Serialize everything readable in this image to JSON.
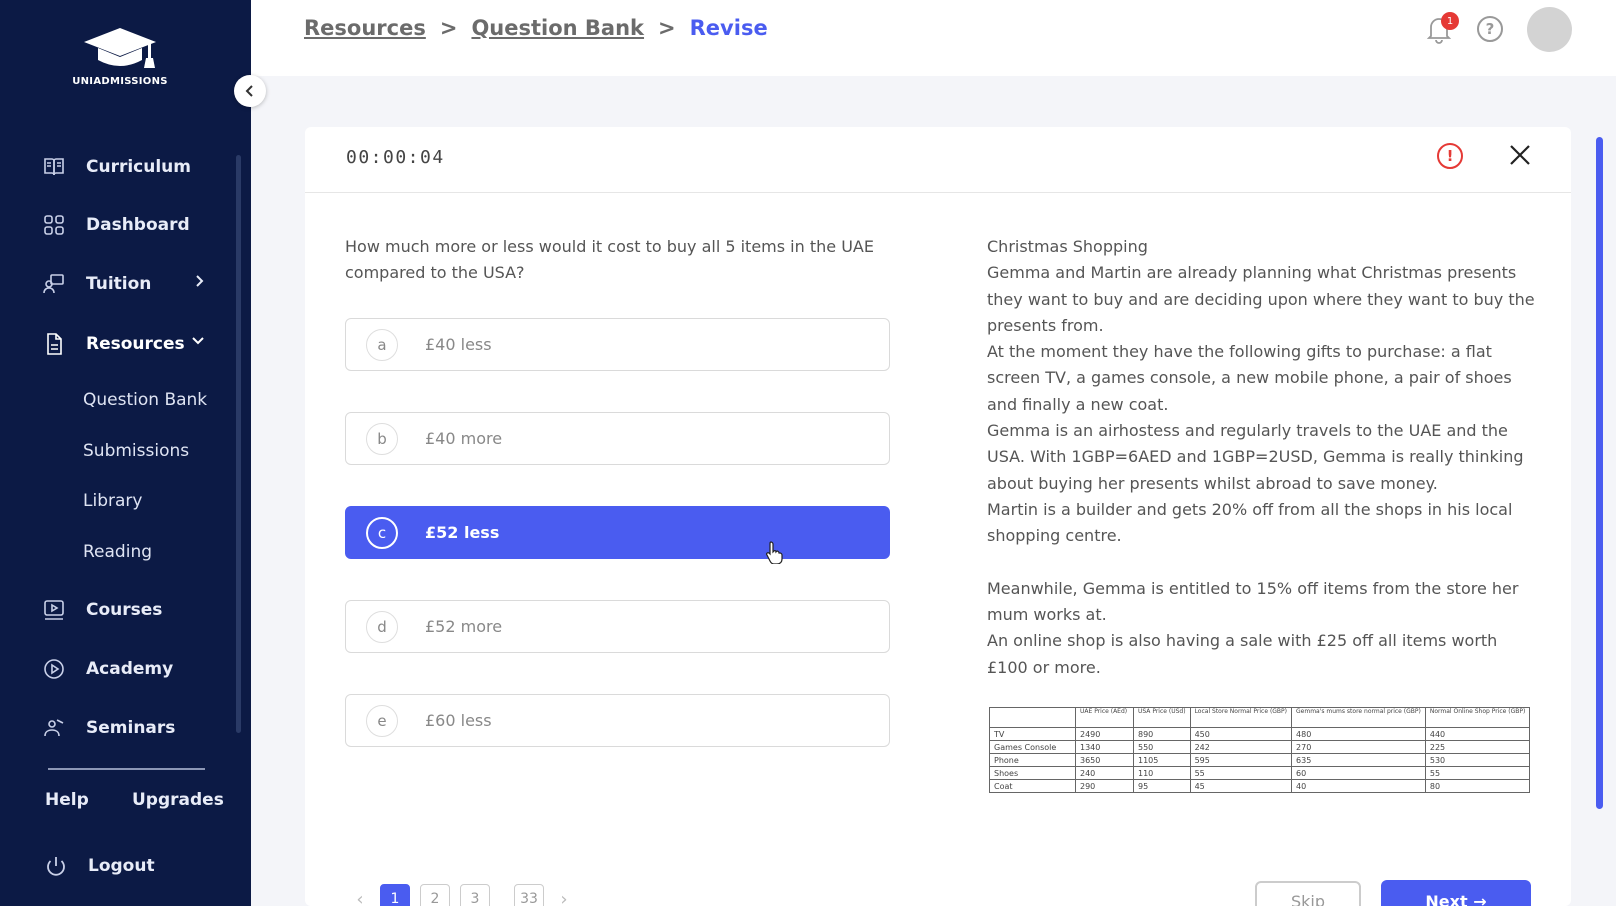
{
  "brand": {
    "name": "UNIADMISSIONS"
  },
  "sidebar": {
    "items": [
      {
        "label": "Curriculum",
        "icon": "book-icon"
      },
      {
        "label": "Dashboard",
        "icon": "grid-icon"
      },
      {
        "label": "Tuition",
        "icon": "tutor-icon"
      },
      {
        "label": "Resources",
        "icon": "document-icon"
      },
      {
        "label": "Courses",
        "icon": "video-icon"
      },
      {
        "label": "Academy",
        "icon": "play-icon"
      },
      {
        "label": "Seminars",
        "icon": "presenter-icon"
      }
    ],
    "resources_sub": [
      "Question Bank",
      "Submissions",
      "Library",
      "Reading"
    ],
    "help_label": "Help",
    "upgrades_label": "Upgrades",
    "logout_label": "Logout"
  },
  "breadcrumb": {
    "items": [
      "Resources",
      "Question Bank"
    ],
    "separator": ">",
    "current": "Revise"
  },
  "header": {
    "notification_count": "1",
    "help_glyph": "?"
  },
  "quiz": {
    "timer": "00:00:04",
    "report_glyph": "!",
    "question": "How much more or less would it cost to buy all 5 items in the UAE compared to the USA?",
    "options": [
      {
        "letter": "a",
        "text": "£40 less"
      },
      {
        "letter": "b",
        "text": "£40 more"
      },
      {
        "letter": "c",
        "text": "£52 less"
      },
      {
        "letter": "d",
        "text": "£52 more"
      },
      {
        "letter": "e",
        "text": "£60 less"
      }
    ],
    "selected": "c",
    "passage": [
      "Christmas Shopping",
      "Gemma and Martin are already planning what Christmas presents they want to buy and are deciding upon where they want to buy the presents from.",
      "At the moment they have the following gifts to purchase: a flat screen TV, a games console, a new mobile phone, a pair of shoes and finally a new coat.",
      "Gemma is an airhostess and regularly travels to the UAE and the USA. With 1GBP=6AED and 1GBP=2USD, Gemma is really thinking about buying her presents whilst abroad to save money.",
      "Martin is a builder and gets 20% off from all the shops in his local shopping centre.",
      "",
      "Meanwhile, Gemma is entitled to 15% off items from the store her mum works at.",
      "An online shop is also having a sale with £25 off all items worth £100 or more."
    ],
    "table": {
      "headers": [
        "",
        "UAE Price (AEd)",
        "USA Price (USd)",
        "Local Store Normal Price (GBP)",
        "Gemma's mums store normal price (GBP)",
        "Normal Online Shop Price (GBP)"
      ],
      "rows": [
        [
          "TV",
          "2490",
          "890",
          "450",
          "480",
          "440"
        ],
        [
          "Games Console",
          "1340",
          "550",
          "242",
          "270",
          "225"
        ],
        [
          "Phone",
          "3650",
          "1105",
          "595",
          "635",
          "530"
        ],
        [
          "Shoes",
          "240",
          "110",
          "55",
          "60",
          "55"
        ],
        [
          "Coat",
          "290",
          "95",
          "45",
          "40",
          "80"
        ]
      ]
    },
    "pagination": {
      "pages": [
        "1",
        "2",
        "3",
        "33"
      ],
      "current": "1",
      "prev": "‹",
      "next": "›"
    },
    "skip_label": "Skip",
    "next_label": "Next →"
  },
  "colors": {
    "sidebar": "#0c1a45",
    "accent": "#4a5cf0",
    "alert": "#e53935"
  }
}
